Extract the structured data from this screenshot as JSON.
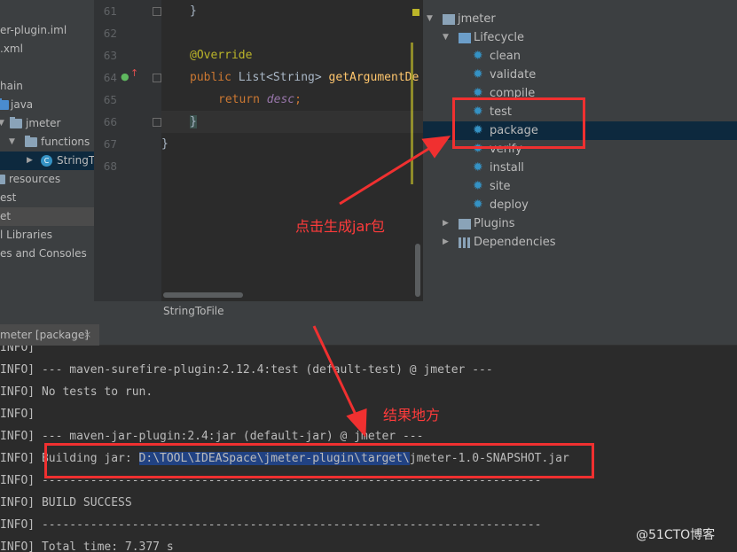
{
  "project_tree": {
    "items": [
      {
        "label": "er-plugin.iml"
      },
      {
        "label": ".xml"
      },
      {
        "label": "hain"
      },
      {
        "label": "java"
      },
      {
        "label": "jmeter"
      },
      {
        "label": "functions"
      },
      {
        "label": "StringT"
      },
      {
        "label": "resources"
      },
      {
        "label": "est"
      },
      {
        "label": "et"
      },
      {
        "label": "l Libraries"
      },
      {
        "label": "es and Consoles"
      }
    ]
  },
  "editor": {
    "line_numbers": [
      "61",
      "62",
      "63",
      "64",
      "65",
      "66",
      "67",
      "68"
    ],
    "code": {
      "l61_brace": "}",
      "l63_annotation": "@Override",
      "l64_kw": "public",
      "l64_type": " List<String> ",
      "l64_method": "getArgumentDe",
      "l65_kw": "return",
      "l65_field": "desc",
      "l65_semicolon": ";",
      "l66_brace": "}",
      "l67_brace": "}"
    },
    "file_tab": "StringToFile"
  },
  "maven": {
    "root": "jmeter",
    "lifecycle": "Lifecycle",
    "goals": [
      "clean",
      "validate",
      "compile",
      "test",
      "package",
      "verify",
      "install",
      "site",
      "deploy"
    ],
    "selected_goal": "package",
    "plugins": "Plugins",
    "dependencies": "Dependencies"
  },
  "run": {
    "tab_label": "meter [package]",
    "close_glyph": "×",
    "lines": [
      "INFO]",
      "INFO] --- maven-surefire-plugin:2.12.4:test (default-test) @ jmeter ---",
      "INFO] No tests to run.",
      "INFO]",
      "INFO] --- maven-jar-plugin:2.4:jar (default-jar) @ jmeter ---",
      "INFO] ",
      "INFO] ------------------------------------------------------------------------",
      "INFO] BUILD SUCCESS",
      "INFO] ------------------------------------------------------------------------",
      "INFO] Total time: 7.377 s"
    ],
    "building_prefix": "Building jar: ",
    "building_path": "D:\\TOOL\\IDEASpace\\jmeter-plugin\\target\\",
    "building_file": "jmeter-1.0-SNAPSHOT.jar"
  },
  "annotations": {
    "click_text": "点击生成jar包",
    "result_text": "结果地方",
    "color": "#f03030"
  },
  "watermark": "@51CTO博客"
}
